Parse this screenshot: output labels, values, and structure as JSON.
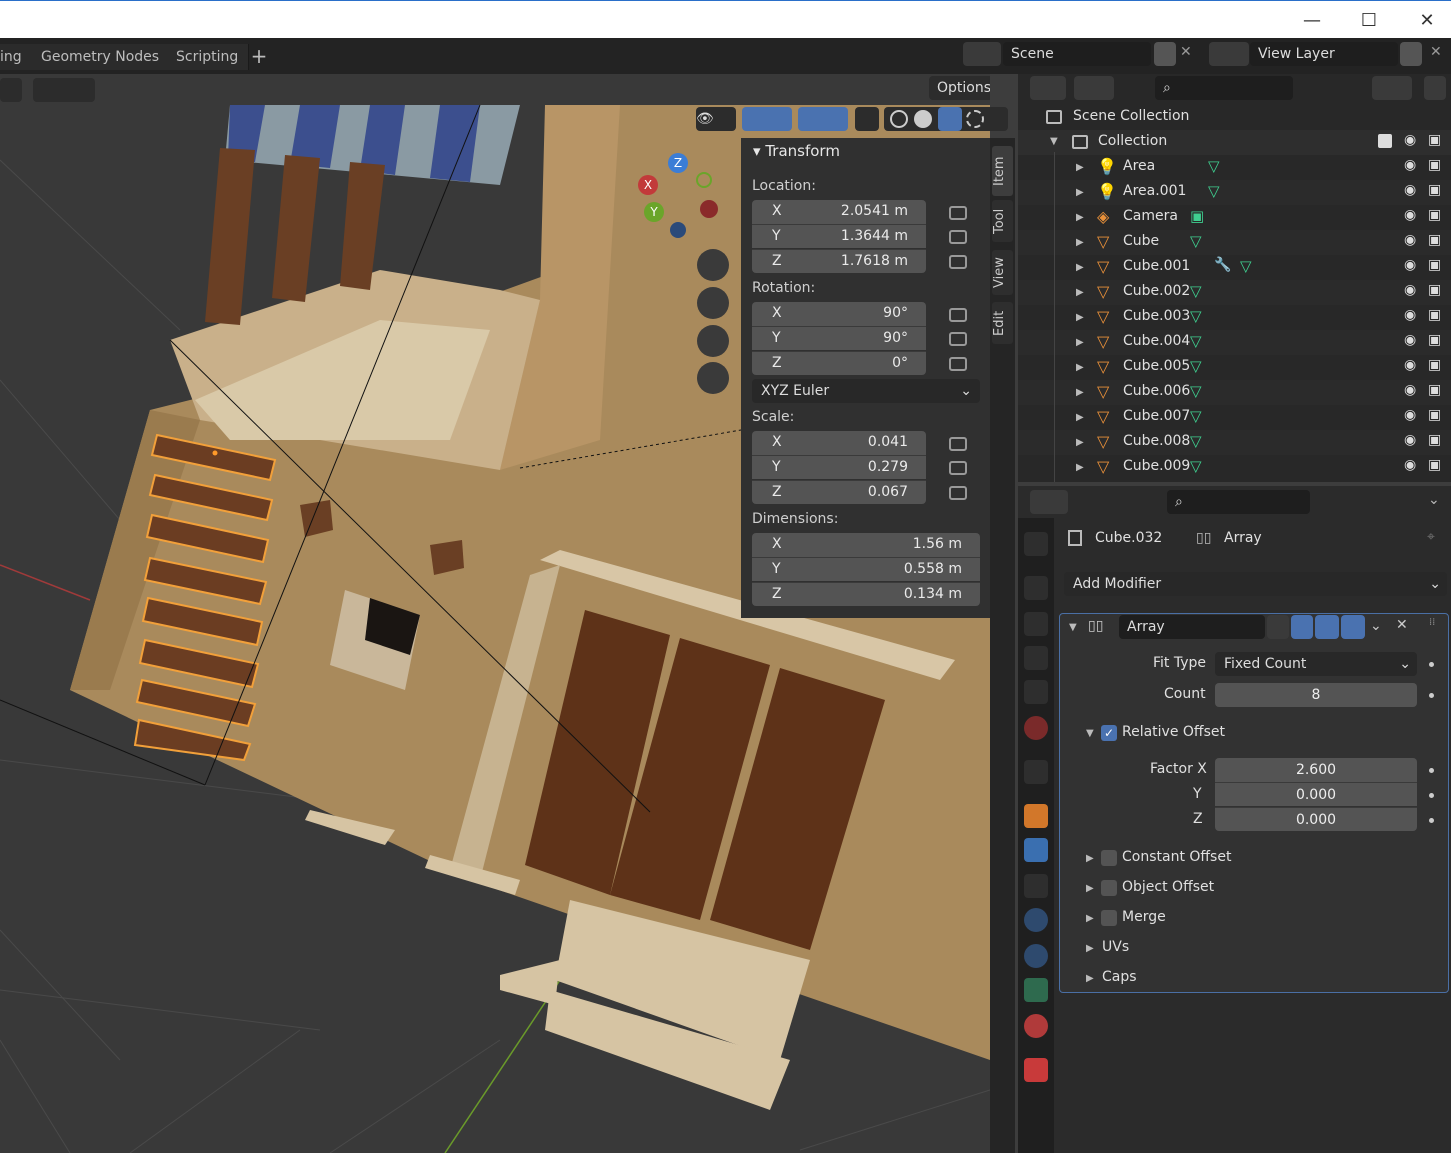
{
  "window": {
    "minimize": "—",
    "maximize": "☐",
    "close": "✕"
  },
  "workspace_tabs": [
    "ing",
    "Geometry Nodes",
    "Scripting"
  ],
  "scene": {
    "label": "Scene"
  },
  "view_layer": {
    "label": "View Layer"
  },
  "viewport": {
    "options_label": "Options"
  },
  "gizmo": {
    "x": "X",
    "y": "Y",
    "z": "Z"
  },
  "npanel": {
    "title": "Transform",
    "location_label": "Location:",
    "location": [
      {
        "axis": "X",
        "value": "2.0541 m"
      },
      {
        "axis": "Y",
        "value": "1.3644 m"
      },
      {
        "axis": "Z",
        "value": "1.7618 m"
      }
    ],
    "rotation_label": "Rotation:",
    "rotation": [
      {
        "axis": "X",
        "value": "90°"
      },
      {
        "axis": "Y",
        "value": "90°"
      },
      {
        "axis": "Z",
        "value": "0°"
      }
    ],
    "rotation_mode": "XYZ Euler",
    "scale_label": "Scale:",
    "scale": [
      {
        "axis": "X",
        "value": "0.041"
      },
      {
        "axis": "Y",
        "value": "0.279"
      },
      {
        "axis": "Z",
        "value": "0.067"
      }
    ],
    "dimensions_label": "Dimensions:",
    "dimensions": [
      {
        "axis": "X",
        "value": "1.56 m"
      },
      {
        "axis": "Y",
        "value": "0.558 m"
      },
      {
        "axis": "Z",
        "value": "0.134 m"
      }
    ]
  },
  "side_tabs": [
    "Item",
    "Tool",
    "View",
    "Edit"
  ],
  "outliner": {
    "scene_collection": "Scene Collection",
    "collection": "Collection",
    "items": [
      "Area",
      "Area.001",
      "Camera",
      "Cube",
      "Cube.001",
      "Cube.002",
      "Cube.003",
      "Cube.004",
      "Cube.005",
      "Cube.006",
      "Cube.007",
      "Cube.008",
      "Cube.009"
    ]
  },
  "properties": {
    "object_name": "Cube.032",
    "modifier_crumb": "Array",
    "add_modifier": "Add Modifier",
    "modifier_name": "Array",
    "fit_type_label": "Fit Type",
    "fit_type_value": "Fixed Count",
    "count_label": "Count",
    "count_value": "8",
    "relative_offset": "Relative Offset",
    "factor_x_label": "Factor X",
    "factor_x": "2.600",
    "factor_y_label": "Y",
    "factor_y": "0.000",
    "factor_z_label": "Z",
    "factor_z": "0.000",
    "constant_offset": "Constant Offset",
    "object_offset": "Object Offset",
    "merge": "Merge",
    "uvs": "UVs",
    "caps": "Caps"
  }
}
